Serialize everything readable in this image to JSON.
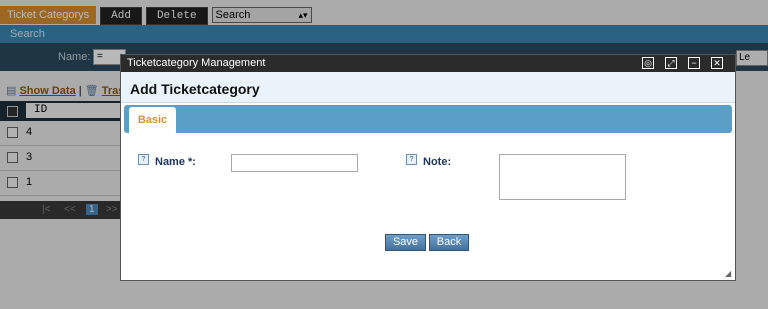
{
  "background": {
    "tab_label": "Ticket Categorys",
    "toolbar": {
      "add_label": "Add",
      "delete_label": "Delete"
    },
    "search_select": {
      "value": "Search"
    },
    "search_bar_label": "Search",
    "filter": {
      "name_label": "Name:",
      "operator": "=",
      "right_select_value": "Le"
    },
    "links": {
      "show_data": "Show Data",
      "separator": "|",
      "trash": "Trash"
    },
    "grid": {
      "header_id": "ID",
      "rows": [
        {
          "id": "4"
        },
        {
          "id": "3"
        },
        {
          "id": "1"
        }
      ]
    },
    "pager": {
      "first": "|<",
      "prev": "<<",
      "current": "1",
      "next": ">>"
    }
  },
  "dialog": {
    "window_title": "Ticketcategory Management",
    "heading": "Add Ticketcategory",
    "tab_basic": "Basic",
    "name_label": "Name *:",
    "name_value": "",
    "note_label": "Note:",
    "note_value": "",
    "save_label": "Save",
    "back_label": "Back"
  },
  "colors": {
    "accent_orange": "#d8902e",
    "header_blue": "#3b8ab4",
    "tabstrip_blue": "#5b9ec6",
    "titlebar_dark": "#2b2b2b"
  }
}
